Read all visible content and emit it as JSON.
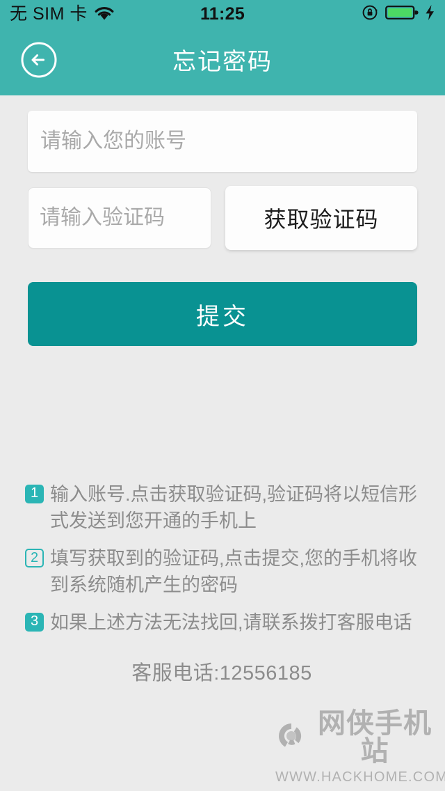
{
  "statusbar": {
    "carrier": "无 SIM 卡",
    "wifi_icon": "wifi-icon",
    "time": "11:25",
    "rotation_lock_icon": "rotation-lock-icon",
    "battery_icon": "battery-full-icon",
    "charging_icon": "charging-bolt-icon"
  },
  "header": {
    "back_icon": "back-arrow-icon",
    "title": "忘记密码",
    "background_color": "#3fb4ae"
  },
  "form": {
    "account": {
      "value": "",
      "placeholder": "请输入您的账号"
    },
    "code": {
      "value": "",
      "placeholder": "请输入验证码"
    },
    "get_code_label": "获取验证码",
    "submit_label": "提交",
    "submit_color": "#099292"
  },
  "tips": {
    "items": [
      {
        "number": "1",
        "style": "filled",
        "text": "输入账号.点击获取验证码,验证码将以短信形式发送到您开通的手机上"
      },
      {
        "number": "2",
        "style": "outline",
        "text": "填写获取到的验证码,点击提交,您的手机将收到系统随机产生的密码"
      },
      {
        "number": "3",
        "style": "filled",
        "text": "如果上述方法无法找回,请联系拨打客服电话"
      }
    ],
    "badge_color": "#2bb5b5",
    "text_color": "#8c8c8c"
  },
  "hotline": "客服电话:12556185",
  "watermark": {
    "logo_icon": "hackhome-logo-icon",
    "name": "网侠手机站",
    "url": "WWW.HACKHOME.COM"
  },
  "page": {
    "background_color": "#ebebeb"
  }
}
